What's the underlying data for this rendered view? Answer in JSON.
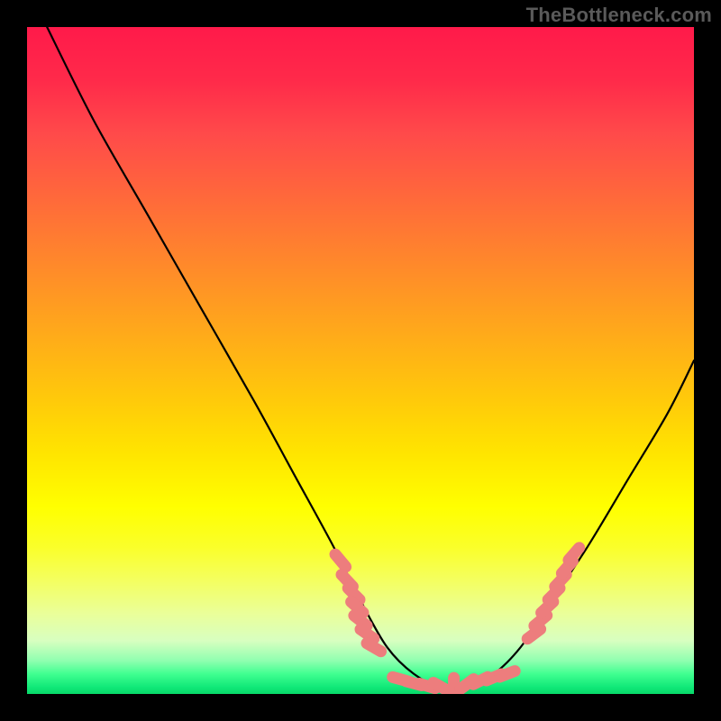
{
  "watermark": "TheBottleneck.com",
  "chart_data": {
    "type": "line",
    "title": "",
    "xlabel": "",
    "ylabel": "",
    "xlim": [
      0,
      100
    ],
    "ylim": [
      0,
      100
    ],
    "grid": false,
    "legend": false,
    "series": [
      {
        "name": "bottleneck-curve",
        "color": "#000000",
        "x": [
          3,
          10,
          18,
          26,
          34,
          40,
          46,
          50,
          54,
          58,
          62,
          66,
          70,
          74,
          78,
          84,
          90,
          96,
          100
        ],
        "values": [
          100,
          86,
          72,
          58,
          44,
          33,
          22,
          14,
          7,
          3,
          1,
          1,
          3,
          7,
          13,
          22,
          32,
          42,
          50
        ]
      }
    ],
    "annotations": {
      "scatter_clusters": [
        {
          "name": "left-cluster",
          "color": "#ed7d7d",
          "points": [
            {
              "x": 47,
              "y": 20
            },
            {
              "x": 48,
              "y": 17
            },
            {
              "x": 49,
              "y": 15
            },
            {
              "x": 49.5,
              "y": 13
            },
            {
              "x": 50,
              "y": 11
            },
            {
              "x": 51,
              "y": 9
            },
            {
              "x": 52,
              "y": 7
            }
          ]
        },
        {
          "name": "bottom-cluster",
          "color": "#ed7d7d",
          "points": [
            {
              "x": 56,
              "y": 2.2
            },
            {
              "x": 58,
              "y": 1.6
            },
            {
              "x": 60,
              "y": 1.2
            },
            {
              "x": 62,
              "y": 1.1
            },
            {
              "x": 64,
              "y": 1.2
            },
            {
              "x": 66,
              "y": 1.5
            },
            {
              "x": 68,
              "y": 2.0
            },
            {
              "x": 70,
              "y": 2.5
            },
            {
              "x": 72,
              "y": 3.0
            }
          ]
        },
        {
          "name": "right-cluster",
          "color": "#ed7d7d",
          "points": [
            {
              "x": 76,
              "y": 9
            },
            {
              "x": 77,
              "y": 11
            },
            {
              "x": 78,
              "y": 13
            },
            {
              "x": 79,
              "y": 15
            },
            {
              "x": 80,
              "y": 17
            },
            {
              "x": 81,
              "y": 19
            },
            {
              "x": 82,
              "y": 21
            }
          ]
        }
      ]
    },
    "gradient_colors": {
      "top": "#ff1a4a",
      "mid": "#ffff00",
      "bottom": "#10e878"
    }
  }
}
